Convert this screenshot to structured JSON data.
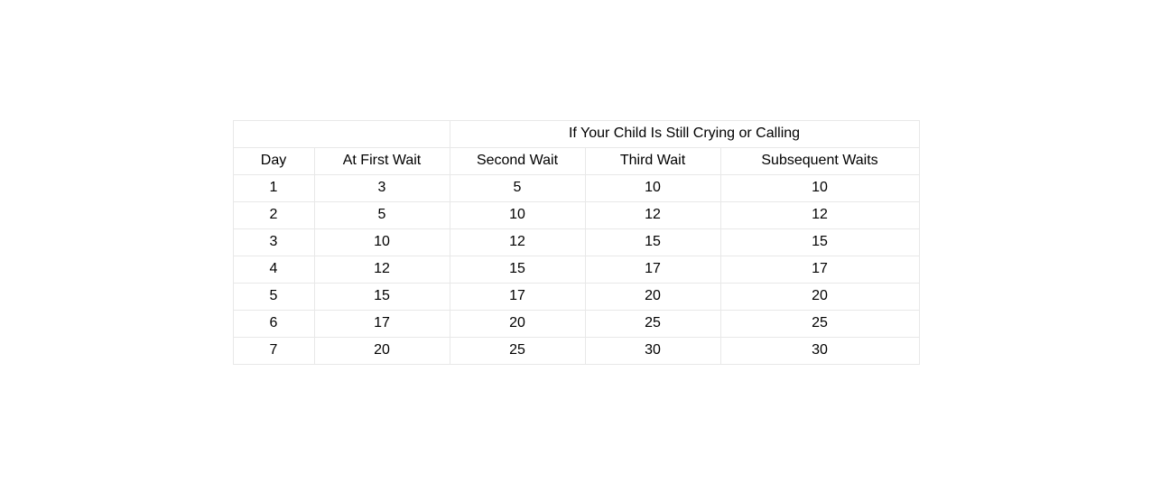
{
  "table": {
    "merged_header": "If Your Child Is Still Crying or Calling",
    "columns": {
      "day": "Day",
      "first_wait": "At First Wait",
      "second_wait": "Second Wait",
      "third_wait": "Third Wait",
      "subsequent_waits": "Subsequent Waits"
    },
    "rows": [
      {
        "day": "1",
        "first_wait": "3",
        "second_wait": "5",
        "third_wait": "10",
        "subsequent_waits": "10"
      },
      {
        "day": "2",
        "first_wait": "5",
        "second_wait": "10",
        "third_wait": "12",
        "subsequent_waits": "12"
      },
      {
        "day": "3",
        "first_wait": "10",
        "second_wait": "12",
        "third_wait": "15",
        "subsequent_waits": "15"
      },
      {
        "day": "4",
        "first_wait": "12",
        "second_wait": "15",
        "third_wait": "17",
        "subsequent_waits": "17"
      },
      {
        "day": "5",
        "first_wait": "15",
        "second_wait": "17",
        "third_wait": "20",
        "subsequent_waits": "20"
      },
      {
        "day": "6",
        "first_wait": "17",
        "second_wait": "20",
        "third_wait": "25",
        "subsequent_waits": "25"
      },
      {
        "day": "7",
        "first_wait": "20",
        "second_wait": "25",
        "third_wait": "30",
        "subsequent_waits": "30"
      }
    ]
  }
}
